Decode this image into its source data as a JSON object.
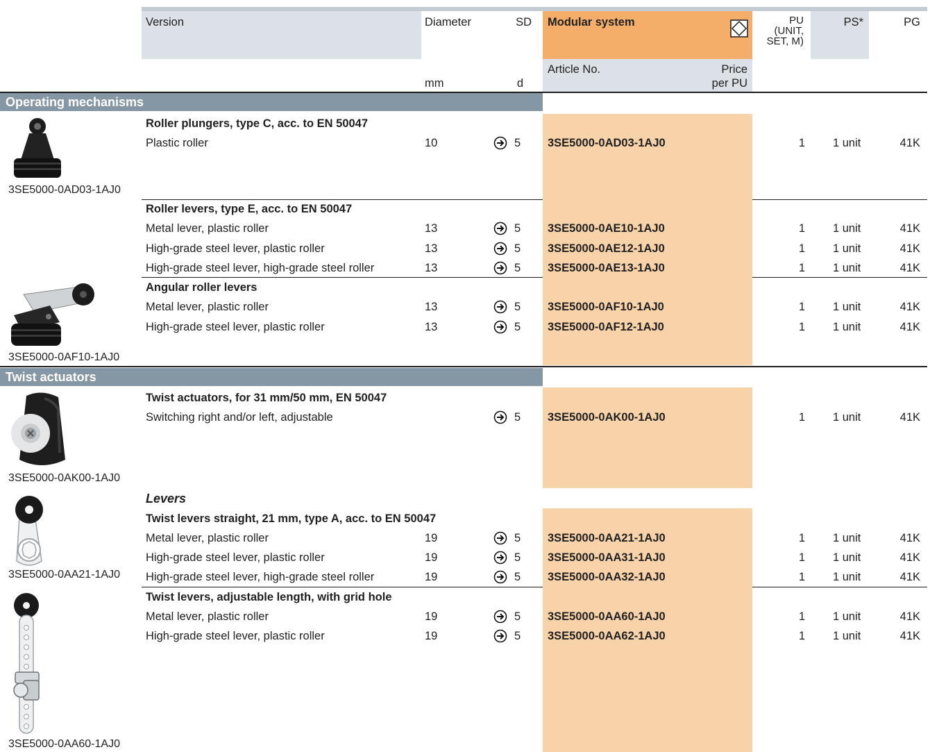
{
  "header": {
    "version": "Version",
    "diameter": "Diameter",
    "diameter_unit": "mm",
    "sd": "SD",
    "sd_unit": "d",
    "modular_system": "Modular system",
    "article_no": "Article No.",
    "price_per_pu_1": "Price",
    "price_per_pu_2": "per PU",
    "pu_1": "PU",
    "pu_2": "(UNIT,",
    "pu_3": "SET, M)",
    "ps": "PS*",
    "pg": "PG"
  },
  "sections": {
    "operating": "Operating mechanisms",
    "twist": "Twist actuators"
  },
  "levers_heading": "Levers",
  "groups": {
    "g1": "Roller plungers, type C, acc. to EN 50047",
    "g2": "Roller levers, type E, acc. to EN 50047",
    "g3": "Angular roller levers",
    "g4": "Twist actuators, for 31 mm/50 mm, EN 50047",
    "g5": "Twist levers straight, 21 mm, type A, acc. to EN 50047",
    "g6": "Twist levers, adjustable length, with grid hole"
  },
  "rows": [
    {
      "desc": "Plastic roller",
      "dia": "10",
      "sd": "5",
      "article": "3SE5000-0AD03-1AJ0",
      "pu": "1",
      "ps": "1 unit",
      "pg": "41K"
    },
    {
      "desc": "Metal lever, plastic roller",
      "dia": "13",
      "sd": "5",
      "article": "3SE5000-0AE10-1AJ0",
      "pu": "1",
      "ps": "1 unit",
      "pg": "41K"
    },
    {
      "desc": "High-grade steel lever, plastic roller",
      "dia": "13",
      "sd": "5",
      "article": "3SE5000-0AE12-1AJ0",
      "pu": "1",
      "ps": "1 unit",
      "pg": "41K"
    },
    {
      "desc": "High-grade steel lever, high-grade steel roller",
      "dia": "13",
      "sd": "5",
      "article": "3SE5000-0AE13-1AJ0",
      "pu": "1",
      "ps": "1 unit",
      "pg": "41K"
    },
    {
      "desc": "Metal lever, plastic roller",
      "dia": "13",
      "sd": "5",
      "article": "3SE5000-0AF10-1AJ0",
      "pu": "1",
      "ps": "1 unit",
      "pg": "41K"
    },
    {
      "desc": "High-grade steel lever, plastic roller",
      "dia": "13",
      "sd": "5",
      "article": "3SE5000-0AF12-1AJ0",
      "pu": "1",
      "ps": "1 unit",
      "pg": "41K"
    },
    {
      "desc": "Switching right and/or left, adjustable",
      "dia": "",
      "sd": "5",
      "article": "3SE5000-0AK00-1AJ0",
      "pu": "1",
      "ps": "1 unit",
      "pg": "41K"
    },
    {
      "desc": "Metal lever, plastic roller",
      "dia": "19",
      "sd": "5",
      "article": "3SE5000-0AA21-1AJ0",
      "pu": "1",
      "ps": "1 unit",
      "pg": "41K"
    },
    {
      "desc": "High-grade steel lever, plastic roller",
      "dia": "19",
      "sd": "5",
      "article": "3SE5000-0AA31-1AJ0",
      "pu": "1",
      "ps": "1 unit",
      "pg": "41K"
    },
    {
      "desc": "High-grade steel lever, high-grade steel roller",
      "dia": "19",
      "sd": "5",
      "article": "3SE5000-0AA32-1AJ0",
      "pu": "1",
      "ps": "1 unit",
      "pg": "41K"
    },
    {
      "desc": "Metal lever, plastic roller",
      "dia": "19",
      "sd": "5",
      "article": "3SE5000-0AA60-1AJ0",
      "pu": "1",
      "ps": "1 unit",
      "pg": "41K"
    },
    {
      "desc": "High-grade steel lever, plastic roller",
      "dia": "19",
      "sd": "5",
      "article": "3SE5000-0AA62-1AJ0",
      "pu": "1",
      "ps": "1 unit",
      "pg": "41K"
    }
  ],
  "captions": {
    "c1": "3SE5000-0AD03-1AJ0",
    "c2": "3SE5000-0AF10-1AJ0",
    "c3": "3SE5000-0AK00-1AJ0",
    "c4": "3SE5000-0AA21-1AJ0",
    "c5": "3SE5000-0AA60-1AJ0"
  },
  "colors": {
    "section_bar": "#8597a4",
    "modular_header": "#f4ae6a",
    "modular_column": "#f8d2a8",
    "header_gray": "#dbe1e6"
  },
  "icons": {
    "sd_arrow": "circle-arrow-right-icon",
    "modular": "diamond-in-square-icon"
  }
}
